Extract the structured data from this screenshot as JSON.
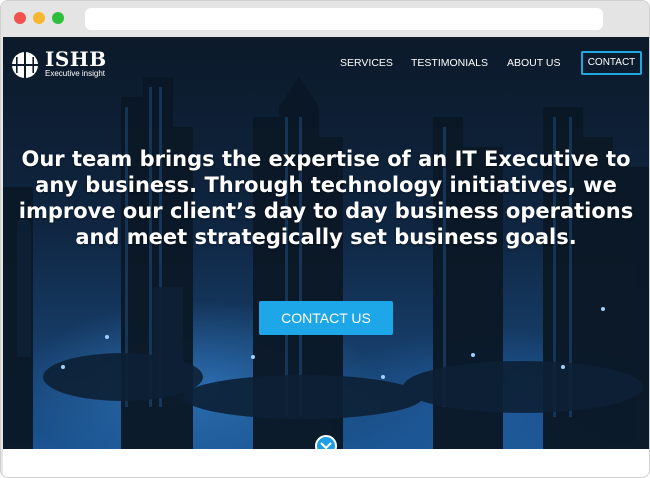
{
  "brand": {
    "name": "ISHB",
    "tagline": "Executive insight"
  },
  "nav": {
    "services": "SERVICES",
    "testimonials": "TESTIMONIALS",
    "about": "ABOUT US",
    "contact": "CONTACT"
  },
  "hero": {
    "headline": {
      "p1": "Our team brings the ",
      "b1": "expertise",
      "p2": " of an ",
      "b2": "IT Executive",
      "p3": " to any business. Through technology initiatives, we ",
      "b3": "improve",
      "p4": " our client’s day to day business operations and meet strategically set ",
      "b4": "business goals."
    },
    "cta_label": "CONTACT US"
  },
  "icons": {
    "logo": "ishb-logo-icon",
    "scroll": "chevron-down-icon"
  },
  "colors": {
    "accent": "#1ea7e8",
    "hero_dark": "#0c1a2a",
    "hero_blue": "#1b5592"
  }
}
